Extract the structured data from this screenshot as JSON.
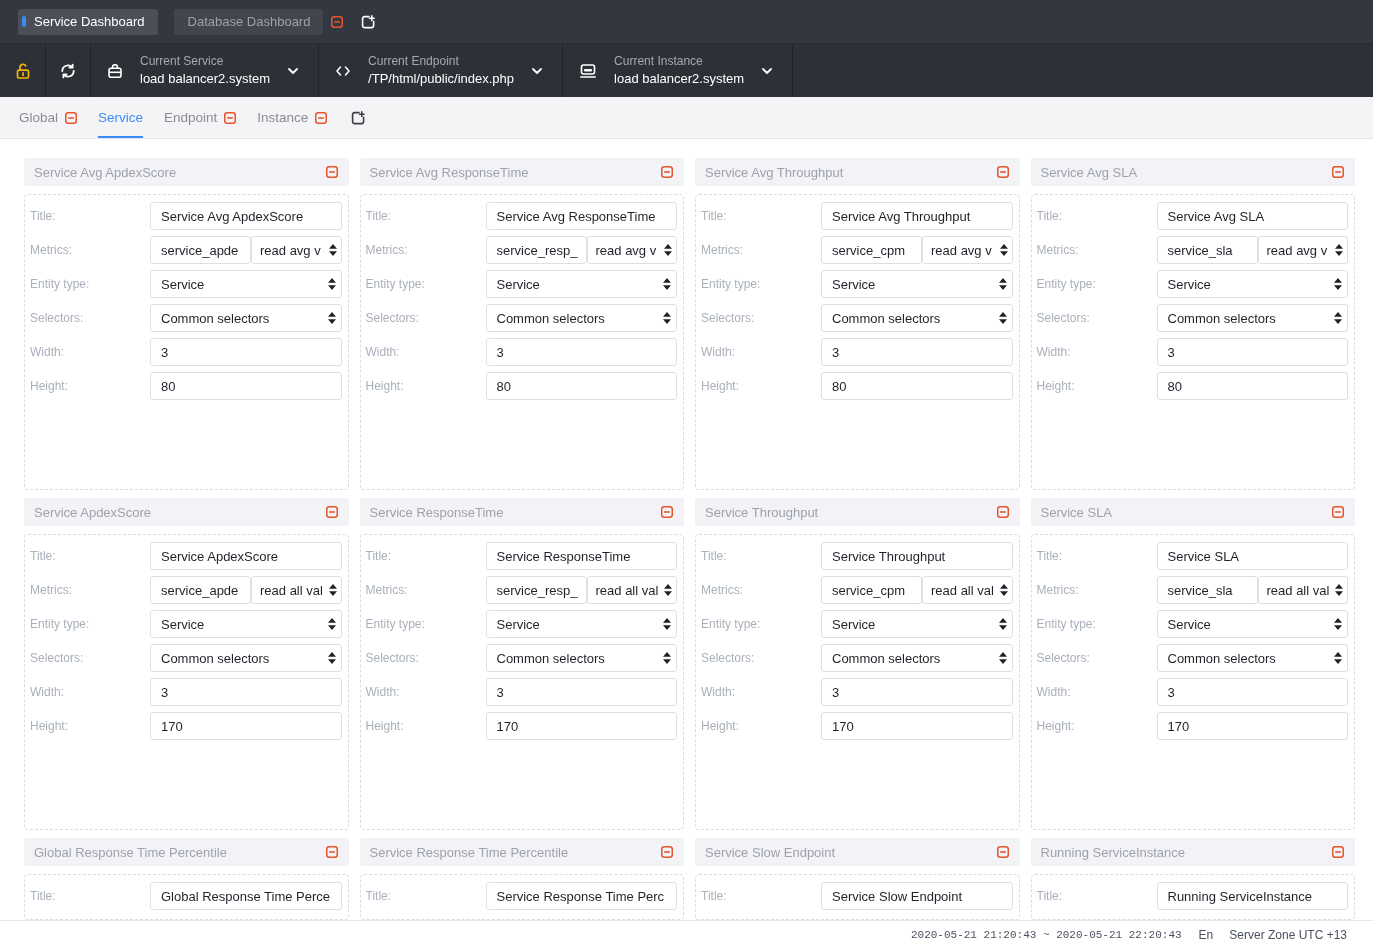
{
  "dashboard_tabs": [
    {
      "label": "Service Dashboard",
      "selected": true
    },
    {
      "label": "Database Dashboard",
      "selected": false
    }
  ],
  "toolbar": {
    "locked": false
  },
  "selectors": [
    {
      "kind": "service",
      "label": "Current Service",
      "value": "load balancer2.system"
    },
    {
      "kind": "endpoint",
      "label": "Current Endpoint",
      "value": "/TP/html/public/index.php"
    },
    {
      "kind": "instance",
      "label": "Current Instance",
      "value": "load balancer2.system"
    }
  ],
  "view_tabs": [
    {
      "label": "Global",
      "selected": false,
      "removable": true
    },
    {
      "label": "Service",
      "selected": true,
      "removable": false
    },
    {
      "label": "Endpoint",
      "selected": false,
      "removable": true
    },
    {
      "label": "Instance",
      "selected": false,
      "removable": true
    }
  ],
  "cards": [
    {
      "title": "Service Avg ApdexScore",
      "fields": [
        {
          "kind": "text",
          "label": "Title:",
          "value": "Service Avg ApdexScore"
        },
        {
          "kind": "metrics",
          "label": "Metrics:",
          "value": "service_apde",
          "aggregation": "read avg v"
        },
        {
          "kind": "select",
          "label": "Entity type:",
          "value": "Service"
        },
        {
          "kind": "select",
          "label": "Selectors:",
          "value": "Common selectors"
        },
        {
          "kind": "text",
          "label": "Width:",
          "value": "3"
        },
        {
          "kind": "text",
          "label": "Height:",
          "value": "80"
        }
      ]
    },
    {
      "title": "Service Avg ResponseTime",
      "fields": [
        {
          "kind": "text",
          "label": "Title:",
          "value": "Service Avg ResponseTime"
        },
        {
          "kind": "metrics",
          "label": "Metrics:",
          "value": "service_resp_",
          "aggregation": "read avg v"
        },
        {
          "kind": "select",
          "label": "Entity type:",
          "value": "Service"
        },
        {
          "kind": "select",
          "label": "Selectors:",
          "value": "Common selectors"
        },
        {
          "kind": "text",
          "label": "Width:",
          "value": "3"
        },
        {
          "kind": "text",
          "label": "Height:",
          "value": "80"
        }
      ]
    },
    {
      "title": "Service Avg Throughput",
      "fields": [
        {
          "kind": "text",
          "label": "Title:",
          "value": "Service Avg Throughput"
        },
        {
          "kind": "metrics",
          "label": "Metrics:",
          "value": "service_cpm",
          "aggregation": "read avg v"
        },
        {
          "kind": "select",
          "label": "Entity type:",
          "value": "Service"
        },
        {
          "kind": "select",
          "label": "Selectors:",
          "value": "Common selectors"
        },
        {
          "kind": "text",
          "label": "Width:",
          "value": "3"
        },
        {
          "kind": "text",
          "label": "Height:",
          "value": "80"
        }
      ]
    },
    {
      "title": "Service Avg SLA",
      "fields": [
        {
          "kind": "text",
          "label": "Title:",
          "value": "Service Avg SLA"
        },
        {
          "kind": "metrics",
          "label": "Metrics:",
          "value": "service_sla",
          "aggregation": "read avg v"
        },
        {
          "kind": "select",
          "label": "Entity type:",
          "value": "Service"
        },
        {
          "kind": "select",
          "label": "Selectors:",
          "value": "Common selectors"
        },
        {
          "kind": "text",
          "label": "Width:",
          "value": "3"
        },
        {
          "kind": "text",
          "label": "Height:",
          "value": "80"
        }
      ]
    },
    {
      "title": "Service ApdexScore",
      "fields": [
        {
          "kind": "text",
          "label": "Title:",
          "value": "Service ApdexScore"
        },
        {
          "kind": "metrics",
          "label": "Metrics:",
          "value": "service_apde",
          "aggregation": "read all val"
        },
        {
          "kind": "select",
          "label": "Entity type:",
          "value": "Service"
        },
        {
          "kind": "select",
          "label": "Selectors:",
          "value": "Common selectors"
        },
        {
          "kind": "text",
          "label": "Width:",
          "value": "3"
        },
        {
          "kind": "text",
          "label": "Height:",
          "value": "170"
        }
      ]
    },
    {
      "title": "Service ResponseTime",
      "fields": [
        {
          "kind": "text",
          "label": "Title:",
          "value": "Service ResponseTime"
        },
        {
          "kind": "metrics",
          "label": "Metrics:",
          "value": "service_resp_",
          "aggregation": "read all val"
        },
        {
          "kind": "select",
          "label": "Entity type:",
          "value": "Service"
        },
        {
          "kind": "select",
          "label": "Selectors:",
          "value": "Common selectors"
        },
        {
          "kind": "text",
          "label": "Width:",
          "value": "3"
        },
        {
          "kind": "text",
          "label": "Height:",
          "value": "170"
        }
      ]
    },
    {
      "title": "Service Throughput",
      "fields": [
        {
          "kind": "text",
          "label": "Title:",
          "value": "Service Throughput"
        },
        {
          "kind": "metrics",
          "label": "Metrics:",
          "value": "service_cpm",
          "aggregation": "read all val"
        },
        {
          "kind": "select",
          "label": "Entity type:",
          "value": "Service"
        },
        {
          "kind": "select",
          "label": "Selectors:",
          "value": "Common selectors"
        },
        {
          "kind": "text",
          "label": "Width:",
          "value": "3"
        },
        {
          "kind": "text",
          "label": "Height:",
          "value": "170"
        }
      ]
    },
    {
      "title": "Service SLA",
      "fields": [
        {
          "kind": "text",
          "label": "Title:",
          "value": "Service SLA"
        },
        {
          "kind": "metrics",
          "label": "Metrics:",
          "value": "service_sla",
          "aggregation": "read all val"
        },
        {
          "kind": "select",
          "label": "Entity type:",
          "value": "Service"
        },
        {
          "kind": "select",
          "label": "Selectors:",
          "value": "Common selectors"
        },
        {
          "kind": "text",
          "label": "Width:",
          "value": "3"
        },
        {
          "kind": "text",
          "label": "Height:",
          "value": "170"
        }
      ]
    },
    {
      "title": "Global Response Time Percentile",
      "fields": [
        {
          "kind": "text",
          "label": "Title:",
          "value": "Global Response Time Perce"
        }
      ]
    },
    {
      "title": "Service Response Time Percentile",
      "fields": [
        {
          "kind": "text",
          "label": "Title:",
          "value": "Service Response Time Perc"
        }
      ]
    },
    {
      "title": "Service Slow Endpoint",
      "fields": [
        {
          "kind": "text",
          "label": "Title:",
          "value": "Service Slow Endpoint"
        }
      ]
    },
    {
      "title": "Running ServiceInstance",
      "fields": [
        {
          "kind": "text",
          "label": "Title:",
          "value": "Running ServiceInstance"
        }
      ]
    }
  ],
  "status_bar": {
    "time_range": "2020-05-21 21:20:43 ~ 2020-05-21 22:20:43",
    "language": "En",
    "server_zone": "Server Zone UTC +13"
  }
}
